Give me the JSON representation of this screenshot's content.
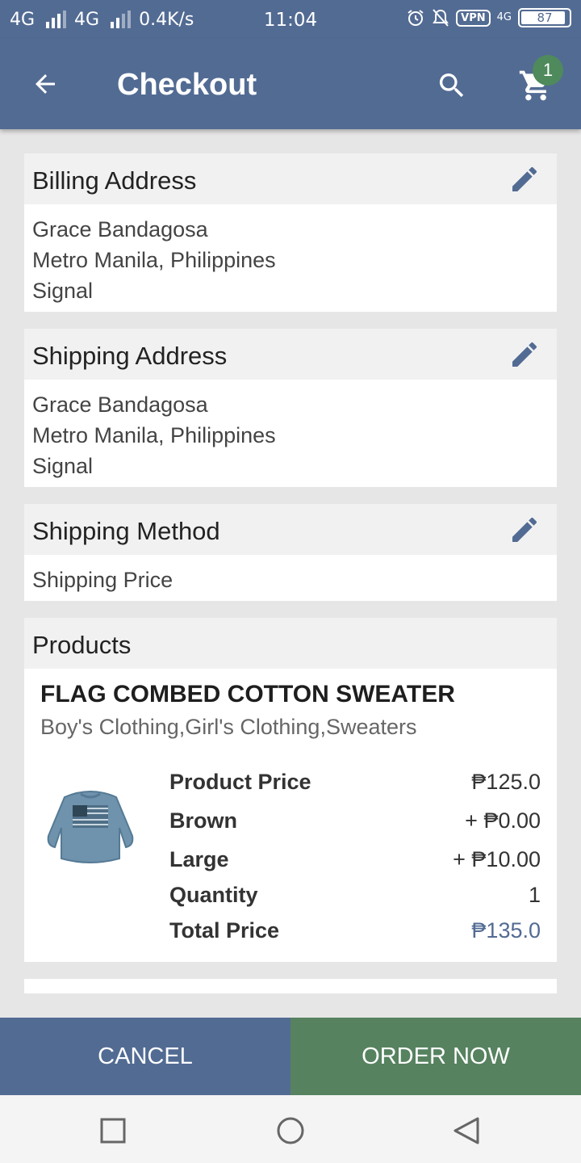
{
  "status_bar": {
    "network1": "4G",
    "network2": "4G",
    "speed": "0.4K/s",
    "time": "11:04",
    "vpn": "VPN",
    "net_small": "4G",
    "battery": "87"
  },
  "app_bar": {
    "title": "Checkout",
    "cart_count": "1"
  },
  "billing": {
    "title": "Billing Address",
    "name": "Grace Bandagosa",
    "region": "Metro Manila, Philippines",
    "extra": "Signal"
  },
  "shipping": {
    "title": "Shipping Address",
    "name": "Grace Bandagosa",
    "region": "Metro Manila, Philippines",
    "extra": "Signal"
  },
  "shipping_method": {
    "title": "Shipping Method",
    "value": "Shipping Price"
  },
  "products": {
    "title": "Products",
    "name": "FLAG COMBED COTTON SWEATER",
    "categories": "Boy's Clothing,Girl's Clothing,Sweaters",
    "rows": [
      {
        "label": "Product Price",
        "value": "₱125.0"
      },
      {
        "label": "Brown",
        "value": "+ ₱0.00"
      },
      {
        "label": "Large",
        "value": "+ ₱10.00"
      },
      {
        "label": "Quantity",
        "value": "1"
      },
      {
        "label": "Total Price",
        "value": "₱135.0"
      }
    ]
  },
  "actions": {
    "cancel": "CANCEL",
    "order": "ORDER NOW"
  },
  "colors": {
    "primary": "#526b93",
    "accent_green": "#56825f"
  }
}
